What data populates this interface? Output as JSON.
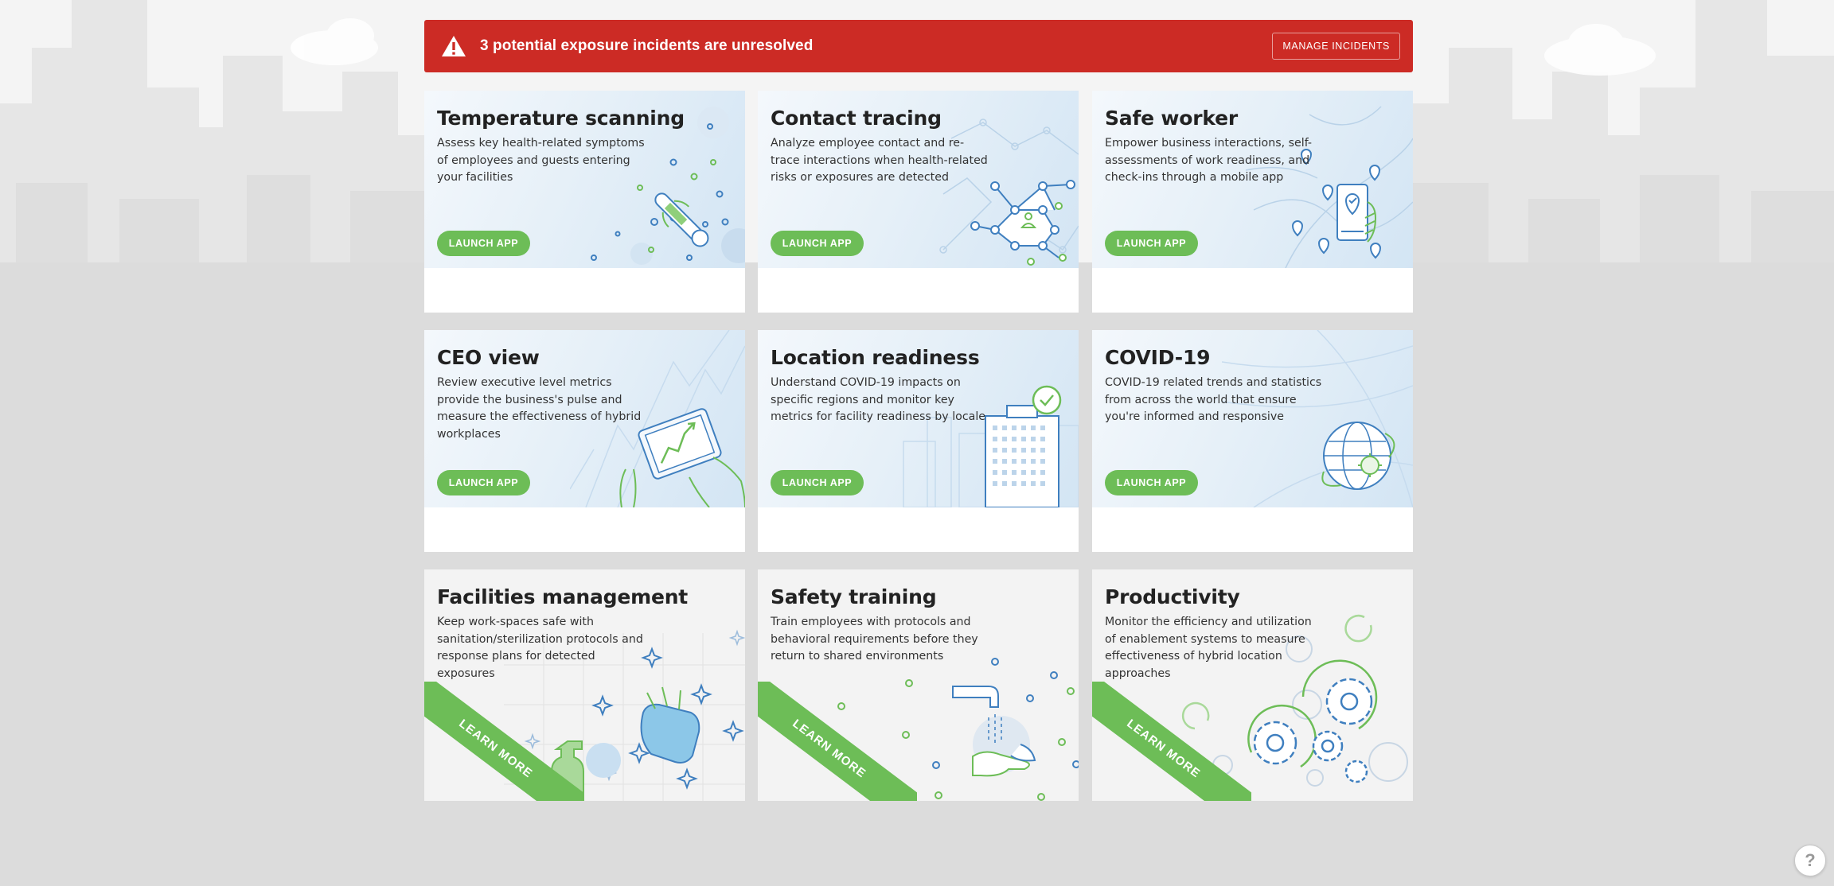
{
  "alert": {
    "message": "3 potential exposure incidents are unresolved",
    "button_label": "MANAGE INCIDENTS",
    "color": "#cc2b25"
  },
  "accent_color": "#6dbd57",
  "cards": [
    {
      "title": "Temperature scanning",
      "description": "Assess key health-related symptoms of employees and guests entering your facilities",
      "action": "LAUNCH APP",
      "icon": "thermometer-icon"
    },
    {
      "title": "Contact tracing",
      "description": "Analyze employee contact and re-trace interactions when health-related risks or exposures are detected",
      "action": "LAUNCH APP",
      "icon": "contact-network-icon"
    },
    {
      "title": "Safe worker",
      "description": "Empower business interactions, self-assessments of work readiness, and check-ins through a mobile app",
      "action": "LAUNCH APP",
      "icon": "mobile-map-pin-icon"
    },
    {
      "title": "CEO view",
      "description": "Review executive level metrics provide the business's pulse and measure the effectiveness of hybrid workplaces",
      "action": "LAUNCH APP",
      "icon": "tablet-chart-icon"
    },
    {
      "title": "Location readiness",
      "description": "Understand COVID-19 impacts on specific regions and monitor key metrics for facility readiness by locale",
      "action": "LAUNCH APP",
      "icon": "building-check-icon"
    },
    {
      "title": "COVID-19",
      "description": "COVID-19 related trends and statistics from across the world that ensure you're informed and responsive",
      "action": "LAUNCH APP",
      "icon": "globe-virus-icon"
    },
    {
      "title": "Facilities management",
      "description": "Keep work-spaces safe with sanitation/sterilization protocols and response plans for detected exposures",
      "action": "LEARN MORE",
      "icon": "spray-glove-icon"
    },
    {
      "title": "Safety training",
      "description": "Train employees with protocols and behavioral requirements before they return to shared environments",
      "action": "LEARN MORE",
      "icon": "hand-washing-icon"
    },
    {
      "title": "Productivity",
      "description": "Monitor the efficiency and utilization of enablement systems to measure effectiveness of hybrid location approaches",
      "action": "LEARN MORE",
      "icon": "gears-icon"
    }
  ],
  "help_label": "?"
}
